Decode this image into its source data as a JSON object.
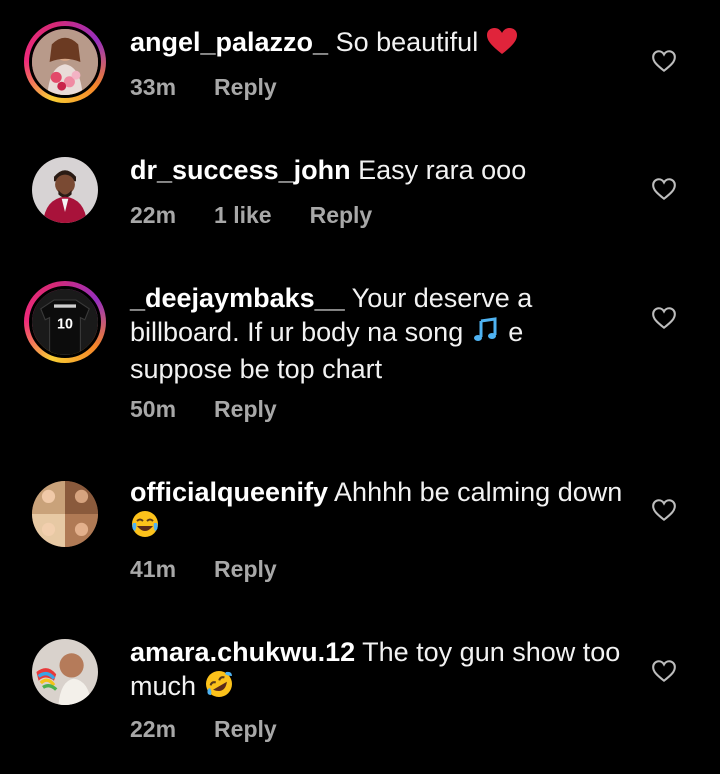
{
  "comments": [
    {
      "username": "angel_palazzo_",
      "text": "So beautiful",
      "emoji": "red-heart",
      "time": "33m",
      "likes": "",
      "reply": "Reply",
      "avatar": "woman-flowers-avatar"
    },
    {
      "username": "dr_success_john",
      "text": "Easy rara ooo",
      "time": "22m",
      "likes": "1 like",
      "reply": "Reply",
      "avatar": "man-red-suit-avatar"
    },
    {
      "username": "_deejaymbaks__",
      "text_a": "Your deserve a billboard. If ur body na song",
      "emoji": "musical-notes",
      "text_b": "e suppose be top chart",
      "time": "50m",
      "likes": "",
      "reply": "Reply",
      "avatar": "jersey-10-avatar",
      "jersey_number": "10"
    },
    {
      "username": "officialqueenify",
      "text": "Ahhhh be calming down",
      "emoji": "face-with-tears-of-joy",
      "time": "41m",
      "likes": "",
      "reply": "Reply",
      "avatar": "collage-women-avatar"
    },
    {
      "username": "amara.chukwu.12",
      "text": "The toy gun show too much",
      "emoji": "rolling-on-floor-laughing",
      "time": "22m",
      "likes": "",
      "reply": "Reply",
      "avatar": "child-with-toy-avatar"
    }
  ],
  "colors": {
    "background": "#000000",
    "text": "#f2f2f2",
    "meta": "#a8a8a8",
    "heart_emoji": "#e0243b",
    "story_ring": [
      "#f9ce34",
      "#ee2a7b",
      "#962fbf"
    ]
  }
}
